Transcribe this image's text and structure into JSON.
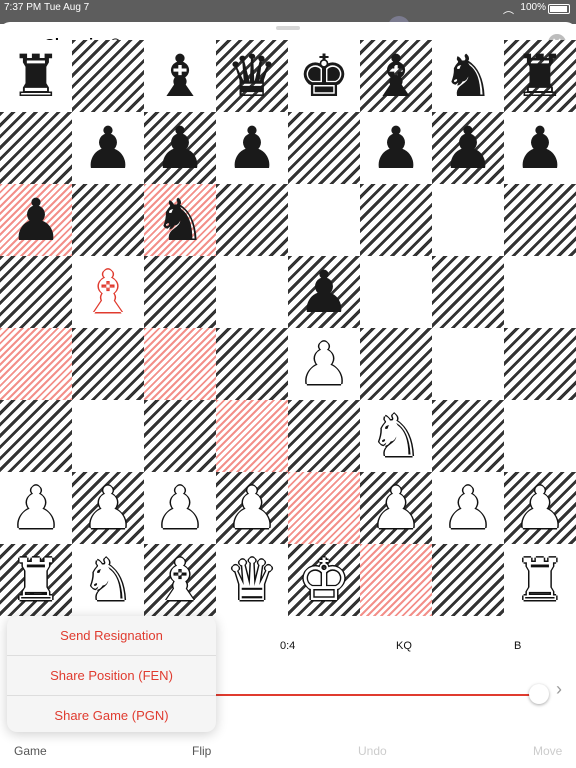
{
  "status_bar": {
    "time": "7:37 PM",
    "date": "Tue Aug 7",
    "battery": "100%"
  },
  "app": {
    "title": "Chessica®",
    "icon_glyph": "♟"
  },
  "board": {
    "squares": [
      [
        "♜",
        "▨",
        "♝",
        "♛",
        "♚",
        "♝",
        "♞",
        "♜"
      ],
      [
        "▨",
        "♟",
        "♟",
        "♟",
        "▨",
        "♟",
        "♟",
        "♟"
      ],
      [
        "♟",
        "▨",
        "♞",
        "▨",
        "",
        "▨",
        "",
        "▨"
      ],
      [
        "▨",
        "♗",
        "▨",
        "",
        "♟",
        "",
        "▨",
        ""
      ],
      [
        "",
        "▨",
        "",
        "▨",
        "♙",
        "▨",
        "",
        "▨"
      ],
      [
        "▨",
        "",
        "▨",
        "",
        "▨",
        "♘",
        "▨",
        ""
      ],
      [
        "♙",
        "♙",
        "♙",
        "♙",
        "▨",
        "♙",
        "♙",
        "♙"
      ],
      [
        "♖",
        "♘",
        "♗",
        "♕",
        "♔",
        "",
        "▨",
        "♖"
      ]
    ],
    "pieces": [
      {
        "sq": "a8",
        "g": "♜",
        "c": "b"
      },
      {
        "sq": "c8",
        "g": "♝",
        "c": "b"
      },
      {
        "sq": "d8",
        "g": "♛",
        "c": "b"
      },
      {
        "sq": "e8",
        "g": "♚",
        "c": "b"
      },
      {
        "sq": "f8",
        "g": "♝",
        "c": "b"
      },
      {
        "sq": "g8",
        "g": "♞",
        "c": "b"
      },
      {
        "sq": "h8",
        "g": "♜",
        "c": "b"
      },
      {
        "sq": "b7",
        "g": "♟",
        "c": "b"
      },
      {
        "sq": "c7",
        "g": "♟",
        "c": "b"
      },
      {
        "sq": "d7",
        "g": "♟",
        "c": "b"
      },
      {
        "sq": "f7",
        "g": "♟",
        "c": "b"
      },
      {
        "sq": "g7",
        "g": "♟",
        "c": "b"
      },
      {
        "sq": "h7",
        "g": "♟",
        "c": "b"
      },
      {
        "sq": "a6",
        "g": "♟",
        "c": "b"
      },
      {
        "sq": "c6",
        "g": "♞",
        "c": "b"
      },
      {
        "sq": "b5",
        "g": "♝",
        "c": "r"
      },
      {
        "sq": "e5",
        "g": "♟",
        "c": "b"
      },
      {
        "sq": "e4",
        "g": "♟",
        "c": "w"
      },
      {
        "sq": "f3",
        "g": "♞",
        "c": "w"
      },
      {
        "sq": "a2",
        "g": "♟",
        "c": "w"
      },
      {
        "sq": "b2",
        "g": "♟",
        "c": "w"
      },
      {
        "sq": "c2",
        "g": "♟",
        "c": "w"
      },
      {
        "sq": "d2",
        "g": "♟",
        "c": "w"
      },
      {
        "sq": "f2",
        "g": "♟",
        "c": "w"
      },
      {
        "sq": "g2",
        "g": "♟",
        "c": "w"
      },
      {
        "sq": "h2",
        "g": "♟",
        "c": "w"
      },
      {
        "sq": "a1",
        "g": "♜",
        "c": "w"
      },
      {
        "sq": "b1",
        "g": "♞",
        "c": "w"
      },
      {
        "sq": "c1",
        "g": "♝",
        "c": "w"
      },
      {
        "sq": "d1",
        "g": "♛",
        "c": "w"
      },
      {
        "sq": "e1",
        "g": "♚",
        "c": "w"
      },
      {
        "sq": "h1",
        "g": "♜",
        "c": "w"
      }
    ],
    "highlights": [
      "a6",
      "c6",
      "a4",
      "c4",
      "d3",
      "e2",
      "f1"
    ],
    "accent_color": "#e03b2f"
  },
  "info": {
    "move_count": "0:4",
    "castling": "KQ",
    "turn": "B"
  },
  "menu": {
    "items": [
      "Send Resignation",
      "Share Position (FEN)",
      "Share Game (PGN)"
    ]
  },
  "toolbar": {
    "game": "Game",
    "flip": "Flip",
    "undo": "Undo",
    "move": "Move"
  }
}
